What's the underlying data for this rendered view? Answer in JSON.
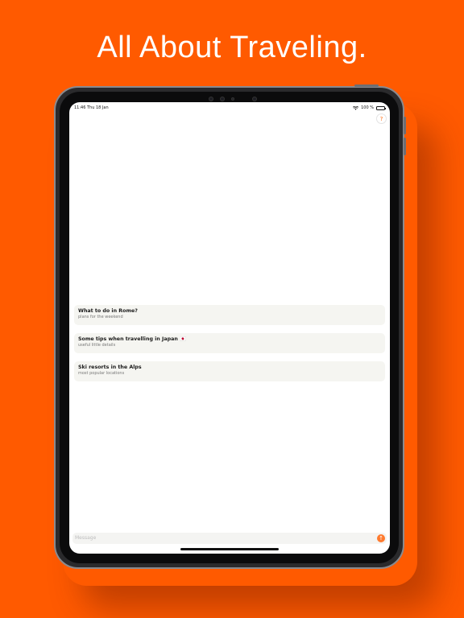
{
  "headline": "All About Traveling.",
  "status_bar": {
    "time": "11:46",
    "date": "Thu 18 Jan",
    "battery": "100 %"
  },
  "help": {
    "label": "?"
  },
  "suggestions": [
    {
      "title": "What to do in Rome?",
      "subtitle": "plans for the weekend"
    },
    {
      "title": "Some tips when travelling in Japan 🇯🇵",
      "subtitle": "useful little details"
    },
    {
      "title": "Ski resorts in the Alps",
      "subtitle": "most popular locations"
    }
  ],
  "composer": {
    "placeholder": "Message",
    "send_icon": "arrow-up-icon",
    "send_symbol": "↑"
  },
  "colors": {
    "background": "#FF5A00",
    "accent": "#FF7A2E",
    "card": "#F5F5F1"
  }
}
